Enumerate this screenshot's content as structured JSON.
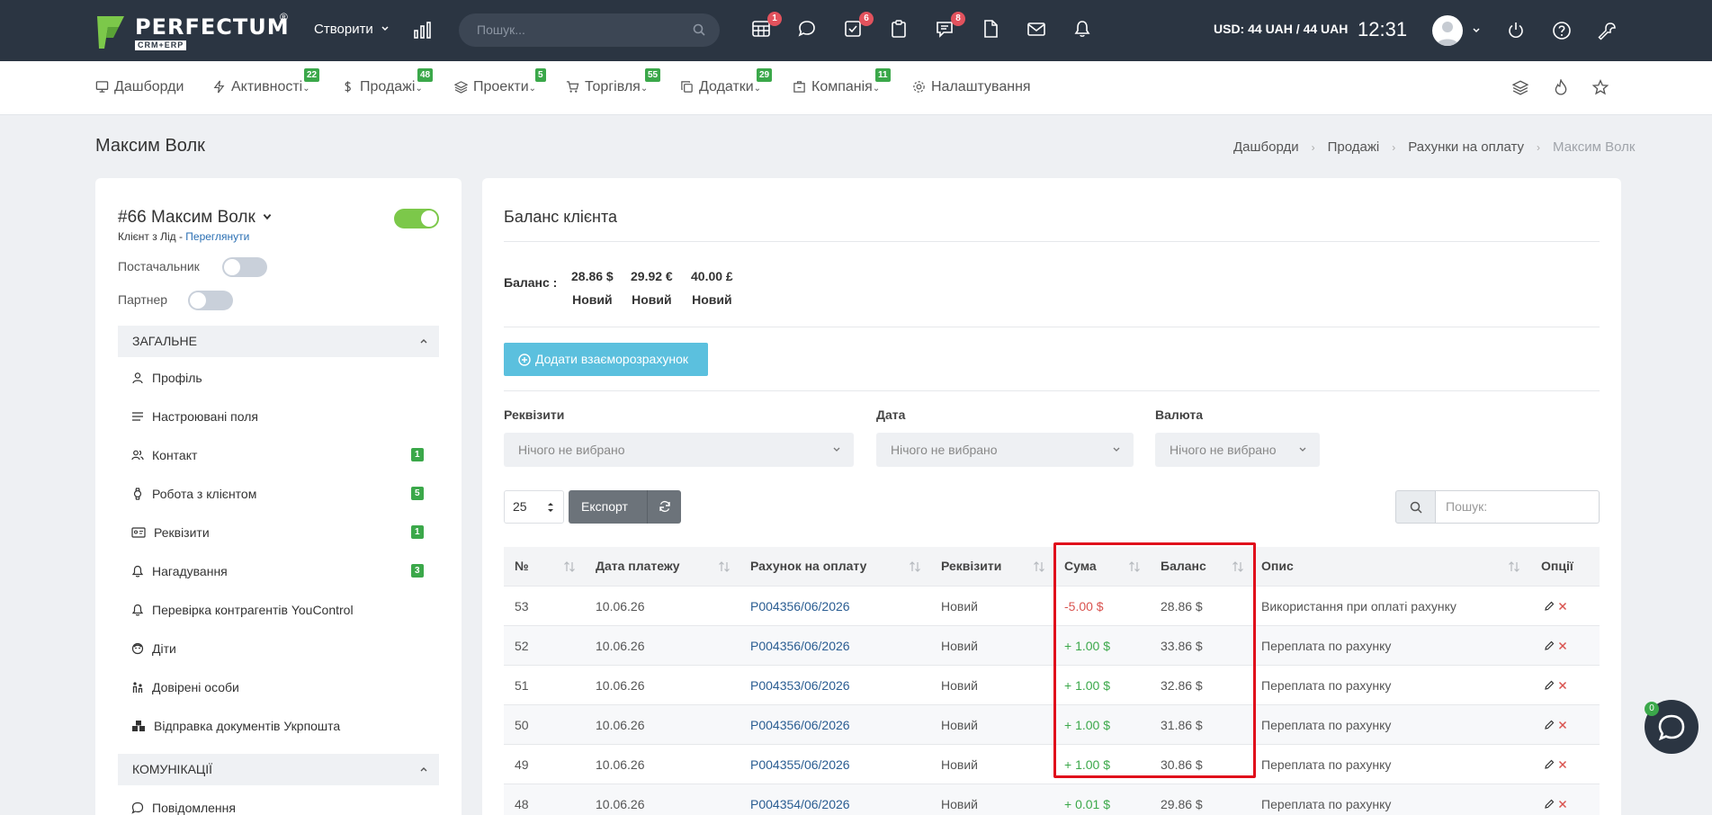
{
  "topbar": {
    "logo_text": "PERFECTUM",
    "logo_reg": "®",
    "logo_sub": "CRM+ERP",
    "create_label": "Створити",
    "search_placeholder": "Пошук...",
    "badges": {
      "calendar": "1",
      "tasks": "6",
      "chat": "8"
    },
    "currency": "USD: 44 UAH / 44 UAH",
    "time": "12:31"
  },
  "nav": {
    "items": [
      {
        "label": "Дашборди",
        "icon": "monitor-icon",
        "badge": ""
      },
      {
        "label": "Активності",
        "icon": "bolt-icon",
        "badge": "22"
      },
      {
        "label": "Продажі",
        "icon": "dollar-icon",
        "badge": "48"
      },
      {
        "label": "Проекти",
        "icon": "layers-icon",
        "badge": "5"
      },
      {
        "label": "Торгівля",
        "icon": "cart-icon",
        "badge": "55"
      },
      {
        "label": "Додатки",
        "icon": "copy-icon",
        "badge": "29"
      },
      {
        "label": "Компанія",
        "icon": "building-icon",
        "badge": "11"
      },
      {
        "label": "Налаштування",
        "icon": "gear-icon",
        "badge": ""
      }
    ]
  },
  "page": {
    "title": "Максим Волк",
    "breadcrumbs": [
      "Дашборди",
      "Продажі",
      "Рахунки на оплату",
      "Максим Волк"
    ]
  },
  "client": {
    "title": "#66 Максим Волк",
    "sub_prefix": "Клієнт з Лід - ",
    "sub_link": "Переглянути",
    "supplier_label": "Постачальник",
    "partner_label": "Партнер",
    "active_toggle": true,
    "supplier_toggle": false,
    "partner_toggle": false
  },
  "sidebar": {
    "section_general": "ЗАГАЛЬНЕ",
    "items": [
      {
        "label": "Профіль",
        "icon": "user-icon",
        "badge": ""
      },
      {
        "label": "Настроювані поля",
        "icon": "list-icon",
        "badge": ""
      },
      {
        "label": "Контакт",
        "icon": "users-icon",
        "badge": "1"
      },
      {
        "label": "Робота з клієнтом",
        "icon": "watch-icon",
        "badge": "5"
      },
      {
        "label": "Реквізити",
        "icon": "id-card-icon",
        "badge": "1"
      },
      {
        "label": "Нагадування",
        "icon": "bell-icon",
        "badge": "3"
      },
      {
        "label": "Перевірка контрагентів YouControl",
        "icon": "bell-icon",
        "badge": ""
      },
      {
        "label": "Діти",
        "icon": "baby-icon",
        "badge": ""
      },
      {
        "label": "Довірені особи",
        "icon": "people-icon",
        "badge": ""
      },
      {
        "label": "Відправка документів Укрпошта",
        "icon": "boxes-icon",
        "badge": ""
      }
    ],
    "section_comm": "КОМУНІКАЦІЇ",
    "comm_items": [
      {
        "label": "Повідомлення",
        "icon": "message-icon"
      }
    ]
  },
  "balance": {
    "title": "Баланс клієнта",
    "label": "Баланс :",
    "values": [
      {
        "amount": "28.86 $",
        "status": "Новий"
      },
      {
        "amount": "29.92 €",
        "status": "Новий"
      },
      {
        "amount": "40.00 £",
        "status": "Новий"
      }
    ],
    "add_button": "Додати взаєморозрахунок"
  },
  "filters": {
    "requisites_label": "Реквізити",
    "date_label": "Дата",
    "currency_label": "Валюта",
    "placeholder": "Нічого не вибрано"
  },
  "table_controls": {
    "page_size": "25",
    "export_label": "Експорт",
    "search_placeholder": "Пошук:"
  },
  "table": {
    "headers": [
      "№",
      "Дата платежу",
      "Рахунок на оплату",
      "Реквізити",
      "Сума",
      "Баланс",
      "Опис",
      "Опції"
    ],
    "rows": [
      {
        "num": "53",
        "date": "10.06.26",
        "invoice": "P004356/06/2026",
        "req": "Новий",
        "sum": "-5.00 $",
        "sum_type": "neg",
        "balance": "28.86 $",
        "desc": "Використання при оплаті рахунку"
      },
      {
        "num": "52",
        "date": "10.06.26",
        "invoice": "P004356/06/2026",
        "req": "Новий",
        "sum": "+ 1.00 $",
        "sum_type": "pos",
        "balance": "33.86 $",
        "desc": "Переплата по рахунку"
      },
      {
        "num": "51",
        "date": "10.06.26",
        "invoice": "P004353/06/2026",
        "req": "Новий",
        "sum": "+ 1.00 $",
        "sum_type": "pos",
        "balance": "32.86 $",
        "desc": "Переплата по рахунку"
      },
      {
        "num": "50",
        "date": "10.06.26",
        "invoice": "P004356/06/2026",
        "req": "Новий",
        "sum": "+ 1.00 $",
        "sum_type": "pos",
        "balance": "31.86 $",
        "desc": "Переплата по рахунку"
      },
      {
        "num": "49",
        "date": "10.06.26",
        "invoice": "P004355/06/2026",
        "req": "Новий",
        "sum": "+ 1.00 $",
        "sum_type": "pos",
        "balance": "30.86 $",
        "desc": "Переплата по рахунку"
      },
      {
        "num": "48",
        "date": "10.06.26",
        "invoice": "P004354/06/2026",
        "req": "Новий",
        "sum": "+ 0.01 $",
        "sum_type": "pos",
        "balance": "29.86 $",
        "desc": "Переплата по рахунку"
      }
    ]
  },
  "chat": {
    "badge": "0"
  },
  "colors": {
    "accent": "#5bc0de",
    "badge_green": "#3ba84a",
    "badge_red": "#e2525d",
    "highlight": "#e00d1b",
    "topbar": "#2b3542"
  }
}
